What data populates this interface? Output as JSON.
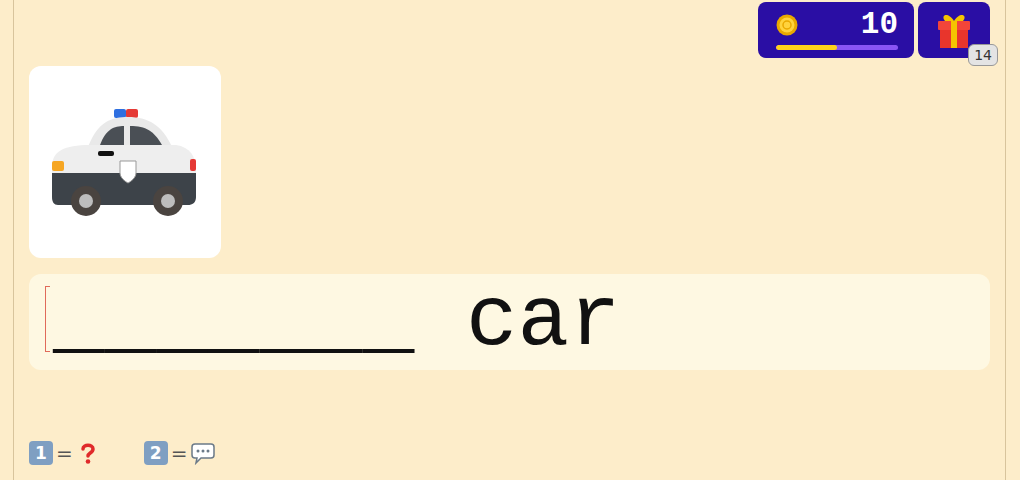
{
  "coins": {
    "count": "10",
    "level": 0.5
  },
  "gifts": {
    "count": "14"
  },
  "word": {
    "masked": "_______",
    "known": "car"
  },
  "hints": [
    {
      "key": "1",
      "sign": "=",
      "kind": "help"
    },
    {
      "key": "2",
      "sign": "=",
      "kind": "chat"
    }
  ]
}
